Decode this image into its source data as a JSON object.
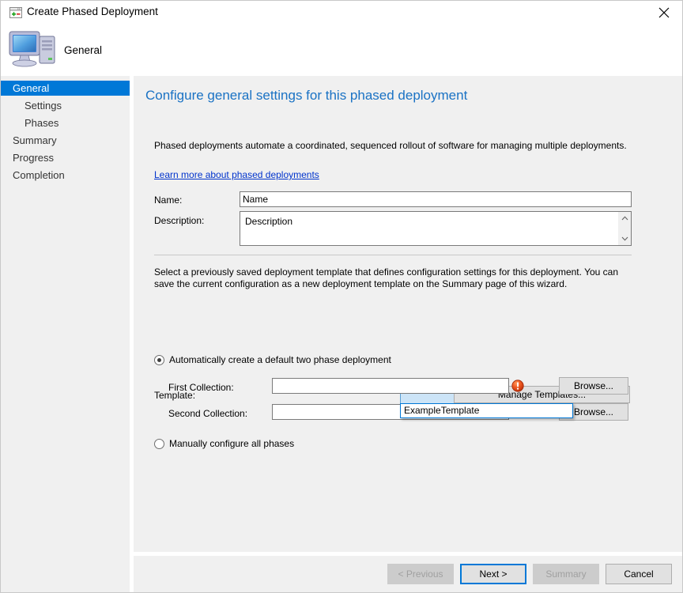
{
  "window": {
    "title": "Create Phased Deployment",
    "icon": "wizard-window-icon",
    "close_label": "✕"
  },
  "header": {
    "icon": "computer-icon",
    "label": "General"
  },
  "sidebar": {
    "items": [
      {
        "label": "General",
        "level": 0,
        "selected": true
      },
      {
        "label": "Settings",
        "level": 1,
        "selected": false
      },
      {
        "label": "Phases",
        "level": 1,
        "selected": false
      },
      {
        "label": "Summary",
        "level": 0,
        "selected": false
      },
      {
        "label": "Progress",
        "level": 0,
        "selected": false
      },
      {
        "label": "Completion",
        "level": 0,
        "selected": false
      }
    ]
  },
  "content": {
    "heading": "Configure general settings for this phased deployment",
    "intro": "Phased deployments automate a coordinated, sequenced rollout of software for managing multiple deployments.",
    "learn_more": "Learn more about phased deployments",
    "name_label": "Name:",
    "name_value": "Name",
    "description_label": "Description:",
    "description_value": "Description",
    "template_intro": "Select a previously saved deployment template that defines configuration settings for this deployment. You can save the current configuration as a new deployment template on the Summary page of this wizard.",
    "template_label": "Template:",
    "template_value": "",
    "template_options": [
      "ExampleTemplate"
    ],
    "manage_templates_label": "Manage Templates...",
    "radio_auto_label": "Automatically create a default two phase deployment",
    "radio_manual_label": "Manually configure all phases",
    "first_collection_label": "First Collection:",
    "first_collection_value": "",
    "second_collection_label": "Second Collection:",
    "second_collection_value": "",
    "browse_label": "Browse...",
    "error_icon": "error-exclamation-icon",
    "error_tooltip": ""
  },
  "footer": {
    "previous_label": "< Previous",
    "next_label": "Next >",
    "summary_label": "Summary",
    "cancel_label": "Cancel"
  },
  "colors": {
    "accent": "#0078d7",
    "heading": "#1a72c4",
    "link": "#0033cc",
    "error": "#e8491b",
    "body_bg": "#f0f0f0"
  }
}
